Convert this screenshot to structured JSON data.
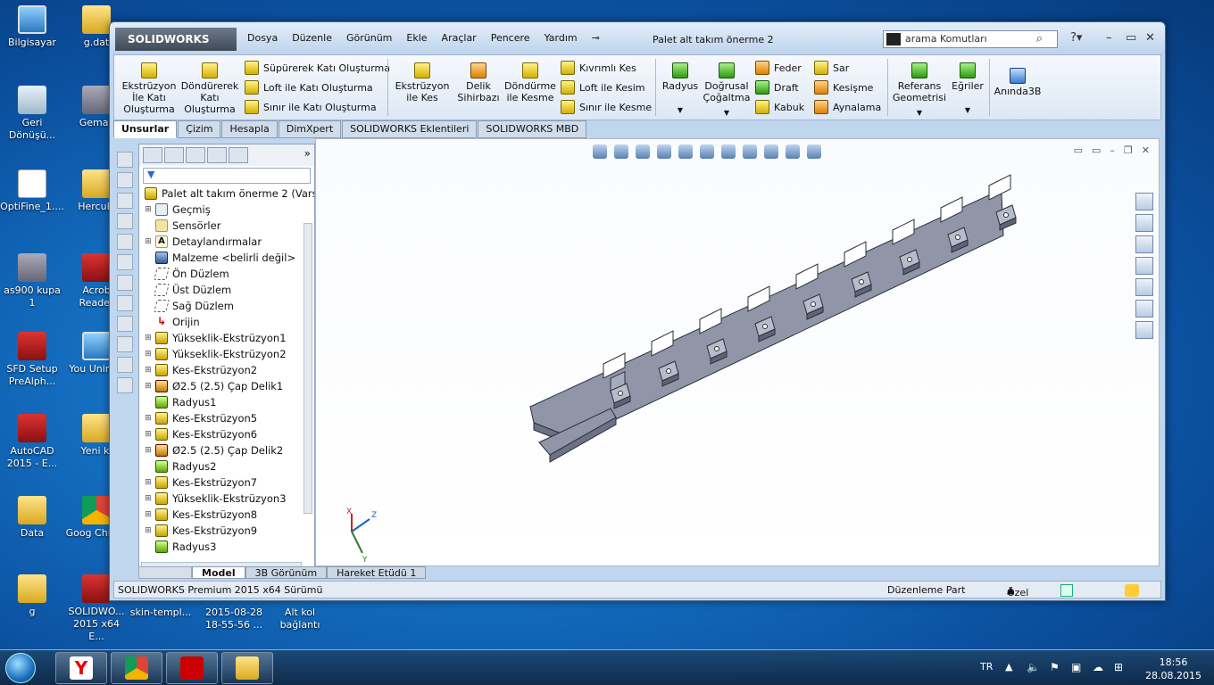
{
  "desktop_icons": [
    {
      "label": "Bilgisayar",
      "icon": "computer-icon"
    },
    {
      "label": "g.dat",
      "icon": "folder-icon"
    },
    {
      "label": "Geri Dönüşü...",
      "icon": "recycle-bin-icon"
    },
    {
      "label": "Gemas",
      "icon": "app-icon"
    },
    {
      "label": "OptiFine_1....",
      "icon": "java-file-icon"
    },
    {
      "label": "HercuLi",
      "icon": "folder-icon"
    },
    {
      "label": "as900 kupa 1",
      "icon": "part-file-icon"
    },
    {
      "label": "Acrob Reader",
      "icon": "acrobat-icon"
    },
    {
      "label": "SFD Setup PreAlph...",
      "icon": "sfd-icon"
    },
    {
      "label": "You Unin-st",
      "icon": "uninstaller-icon"
    },
    {
      "label": "AutoCAD 2015 - E...",
      "icon": "autocad-icon"
    },
    {
      "label": "Yeni kl",
      "icon": "folder-icon"
    },
    {
      "label": "Data",
      "icon": "folder-icon"
    },
    {
      "label": "Goog Chrom",
      "icon": "chrome-icon"
    },
    {
      "label": "g",
      "icon": "folder-icon"
    },
    {
      "label": "SOLIDWO... 2015 x64 E...",
      "icon": "solidworks-icon"
    },
    {
      "label": "skin-templ...",
      "icon": "file-icon"
    },
    {
      "label": "2015-08-28 18-55-56 ...",
      "icon": "file-icon"
    },
    {
      "label": "Alt kol bağlantı",
      "icon": "file-icon"
    }
  ],
  "app": {
    "logo": "SOLIDWORKS",
    "menu": [
      "Dosya",
      "Düzenle",
      "Görünüm",
      "Ekle",
      "Araçlar",
      "Pencere",
      "Yardım"
    ],
    "doc_title": "Palet alt takım önerme 2",
    "search_placeholder": "arama Komutları"
  },
  "ribbon": {
    "big_buttons": [
      {
        "label": "Ekstrüzyon İle Katı Oluşturma"
      },
      {
        "label": "Döndürerek Katı Oluşturma"
      },
      {
        "label": "Ekstrüzyon ile Kes"
      },
      {
        "label": "Delik Sihirbazı"
      },
      {
        "label": "Döndürme ile Kesme"
      },
      {
        "label": "Radyus"
      },
      {
        "label": "Doğrusal Çoğaltma"
      },
      {
        "label": "Referans Geometrisi"
      },
      {
        "label": "Eğriler"
      },
      {
        "label": "Anında3B"
      }
    ],
    "small_buttons": [
      {
        "label": "Süpürerek Katı Oluşturma"
      },
      {
        "label": "Loft ile Katı Oluşturma"
      },
      {
        "label": "Sınır ile Katı Oluşturma"
      },
      {
        "label": "Kıvrımlı Kes"
      },
      {
        "label": "Loft ile Kesim"
      },
      {
        "label": "Sınır ile Kesme"
      },
      {
        "label": "Feder"
      },
      {
        "label": "Draft"
      },
      {
        "label": "Kabuk"
      },
      {
        "label": "Sar"
      },
      {
        "label": "Kesişme"
      },
      {
        "label": "Aynalama"
      }
    ]
  },
  "command_tabs": [
    "Unsurlar",
    "Çizim",
    "Hesapla",
    "DimXpert",
    "SOLIDWORKS Eklentileri",
    "SOLIDWORKS MBD"
  ],
  "feature_tree": {
    "root": "Palet alt takım önerme 2  (Vars",
    "items": [
      {
        "label": "Geçmiş",
        "icon": "history-icon",
        "expandable": true
      },
      {
        "label": "Sensörler",
        "icon": "sensor-icon",
        "expandable": false
      },
      {
        "label": "Detaylandırmalar",
        "icon": "annotation-icon",
        "expandable": true
      },
      {
        "label": "Malzeme <belirli değil>",
        "icon": "material-icon",
        "expandable": false
      },
      {
        "label": "Ön Düzlem",
        "icon": "plane-icon",
        "expandable": false
      },
      {
        "label": "Üst Düzlem",
        "icon": "plane-icon",
        "expandable": false
      },
      {
        "label": "Sağ Düzlem",
        "icon": "plane-icon",
        "expandable": false
      },
      {
        "label": "Orijin",
        "icon": "origin-icon",
        "expandable": false
      },
      {
        "label": "Yükseklik-Ekstrüzyon1",
        "icon": "extrude-icon",
        "expandable": true
      },
      {
        "label": "Yükseklik-Ekstrüzyon2",
        "icon": "extrude-icon",
        "expandable": true
      },
      {
        "label": "Kes-Ekstrüzyon2",
        "icon": "cut-extrude-icon",
        "expandable": true
      },
      {
        "label": "Ø2.5 (2.5) Çap Delik1",
        "icon": "hole-icon",
        "expandable": true
      },
      {
        "label": "Radyus1",
        "icon": "fillet-icon",
        "expandable": false
      },
      {
        "label": "Kes-Ekstrüzyon5",
        "icon": "cut-extrude-icon",
        "expandable": true
      },
      {
        "label": "Kes-Ekstrüzyon6",
        "icon": "cut-extrude-icon",
        "expandable": true
      },
      {
        "label": "Ø2.5 (2.5) Çap Delik2",
        "icon": "hole-icon",
        "expandable": true
      },
      {
        "label": "Radyus2",
        "icon": "fillet-icon",
        "expandable": false
      },
      {
        "label": "Kes-Ekstrüzyon7",
        "icon": "cut-extrude-icon",
        "expandable": true
      },
      {
        "label": "Yükseklik-Ekstrüzyon3",
        "icon": "extrude-icon",
        "expandable": true
      },
      {
        "label": "Kes-Ekstrüzyon8",
        "icon": "cut-extrude-icon",
        "expandable": true
      },
      {
        "label": "Kes-Ekstrüzyon9",
        "icon": "cut-extrude-icon",
        "expandable": true
      },
      {
        "label": "Radyus3",
        "icon": "fillet-icon",
        "expandable": false
      }
    ]
  },
  "bottom_tabs": [
    "Model",
    "3B Görünüm",
    "Hareket Etüdü 1"
  ],
  "status": {
    "version": "SOLIDWORKS Premium 2015 x64 Sürümü",
    "mode": "Düzenleme Part",
    "units": "Özel"
  },
  "taskbar": {
    "apps": [
      "yandex-browser-icon",
      "chrome-icon",
      "solidworks-icon",
      "file-explorer-icon"
    ],
    "lang": "TR",
    "time": "18:56",
    "date": "28.08.2015"
  },
  "viewport": {
    "triad_labels": [
      "Y",
      "Z",
      "X"
    ]
  }
}
